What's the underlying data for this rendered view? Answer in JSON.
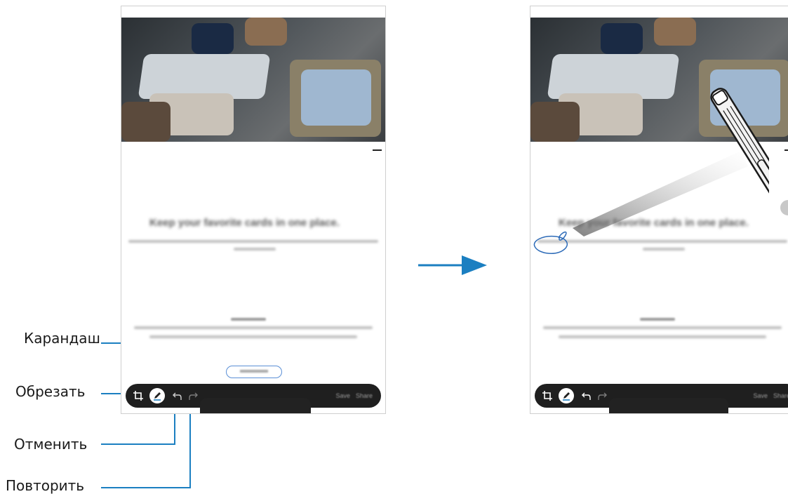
{
  "callouts": {
    "pen": "Карандаш",
    "crop": "Обрезать",
    "undo": "Отменить",
    "redo": "Повторить"
  },
  "left_screen": {
    "heading": "Keep your favorite cards in one place.",
    "toolbar": {
      "right_buttons": [
        "Save",
        "Share"
      ]
    }
  },
  "right_screen": {
    "heading": "Keep your favorite cards in one place.",
    "toolbar": {
      "right_buttons": [
        "Save",
        "Share"
      ]
    }
  },
  "colors": {
    "accent": "#1b7fc1",
    "toolbar_bg": "#1f1f1f"
  },
  "icons": [
    "crop-icon",
    "pen-icon",
    "undo-icon",
    "redo-icon",
    "arrow-right-icon",
    "s-pen-icon"
  ]
}
